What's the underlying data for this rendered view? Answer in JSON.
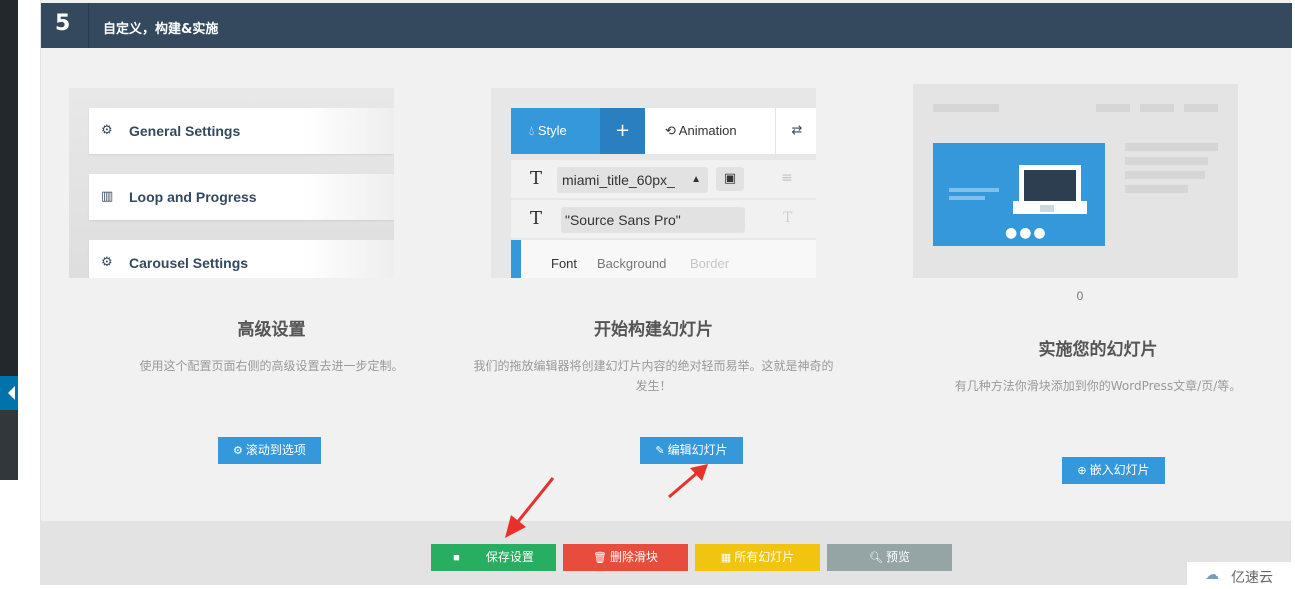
{
  "header": {
    "step_number": "5",
    "title": "自定义，构建&实施"
  },
  "columns": [
    {
      "title": "高级设置",
      "description": "使用这个配置页面右侧的高级设置去进一步定制。",
      "button_label": "滚动到选项",
      "button_icon": "gear-icon",
      "preview": {
        "rows": [
          "General Settings",
          "Loop and Progress",
          "Carousel Settings"
        ]
      }
    },
    {
      "title": "开始构建幻灯片",
      "description_line1": "我们的拖放编辑器将创建幻灯片内容的绝对轻而易举。这就是神奇的",
      "description_line2": "发生！",
      "button_label": "编辑幻灯片",
      "button_icon": "pencil-icon",
      "preview": {
        "tab_style": "Style",
        "tab_plus": "+",
        "tab_animation": "Animation",
        "select_value": "miami_title_60px_",
        "font_value": "\"Source Sans Pro\"",
        "sub_tabs": [
          "Font",
          "Background",
          "Border"
        ]
      }
    },
    {
      "count": "0",
      "title": "实施您的幻灯片",
      "description": "有几种方法你滑块添加到你的WordPress文章/页/等。",
      "button_label": "嵌入幻灯片",
      "button_icon": "plus-circle-icon"
    }
  ],
  "footer": {
    "save_label": "保存设置",
    "delete_label": "删除滑块",
    "all_label": "所有幻灯片",
    "preview_label": "预览"
  },
  "watermark": {
    "text": "亿速云"
  },
  "colors": {
    "header_bg": "#34495e",
    "accent_blue": "#3498db",
    "save_green": "#27ae60",
    "delete_red": "#e74c3c",
    "all_yellow": "#f1c40f",
    "preview_gray": "#95a5a6",
    "annotation_red": "#e8312a"
  }
}
